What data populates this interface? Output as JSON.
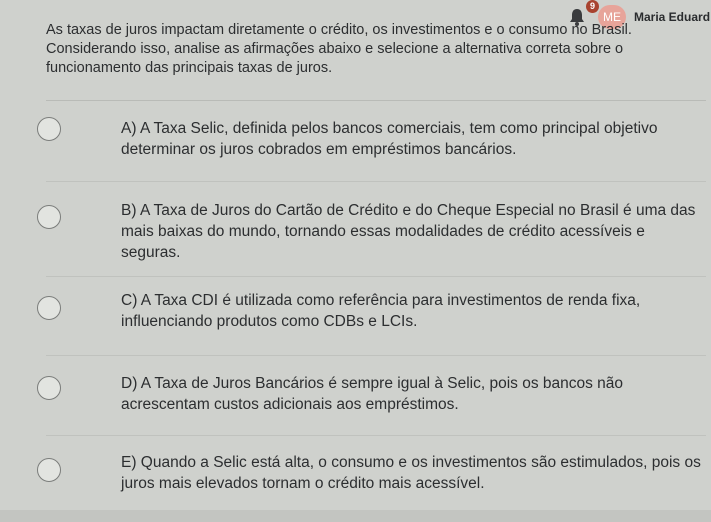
{
  "header": {
    "notification_count": "9",
    "avatar_initials": "ME",
    "user_name": "Maria Eduard",
    "bell_icon": "bell-icon"
  },
  "question": {
    "text": "As taxas de juros impactam diretamente o crédito, os investimentos e o consumo no Brasil. Considerando isso, analise as afirmações abaixo e selecione a alternativa correta sobre o funcionamento das principais taxas de juros."
  },
  "options": [
    {
      "text": "A) A Taxa Selic, definida pelos bancos comerciais, tem como principal objetivo determinar os juros cobrados em empréstimos bancários."
    },
    {
      "text": "B) A Taxa de Juros do Cartão de Crédito e do Cheque Especial no Brasil é uma das mais baixas do mundo, tornando essas modalidades de crédito acessíveis e seguras."
    },
    {
      "text": "C) A Taxa CDI é utilizada como referência para investimentos de renda fixa, influenciando produtos como CDBs e LCIs."
    },
    {
      "text": "D) A Taxa de Juros Bancários é sempre igual à Selic, pois os bancos não acrescentam custos adicionais aos empréstimos."
    },
    {
      "text": "E) Quando a Selic está alta, o consumo e os investimentos são estimulados, pois os juros mais elevados tornam o crédito mais acessível."
    }
  ],
  "colors": {
    "background": "#cfd1cd",
    "badge": "#a8432f",
    "avatar": "#e7a49a"
  }
}
